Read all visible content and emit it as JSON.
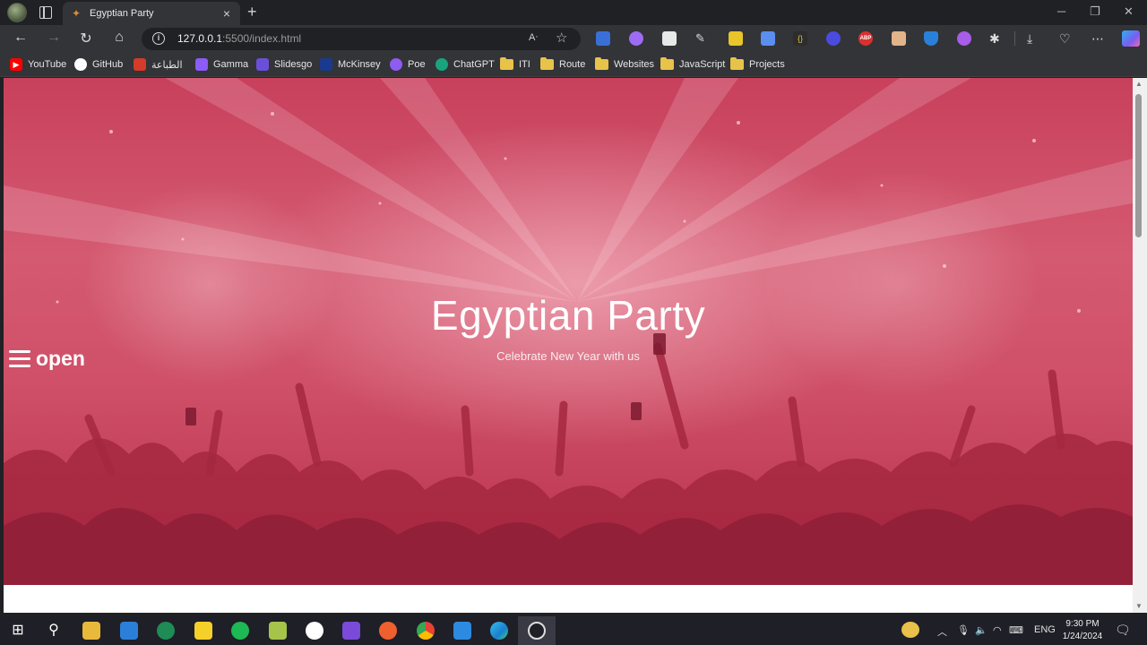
{
  "browser": {
    "tab_title": "Egyptian Party",
    "url_host": "127.0.0.1",
    "url_path": ":5500/index.html",
    "new_tab_symbol": "+",
    "close_tab_symbol": "×"
  },
  "bookmarks": [
    {
      "label": "YouTube",
      "icon": "youtube-icon",
      "color": "#ff0000"
    },
    {
      "label": "GitHub",
      "icon": "github-icon",
      "color": "#ffffff"
    },
    {
      "label": "الطباعة",
      "icon": "printing-icon",
      "color": "#d43b2a"
    },
    {
      "label": "Gamma",
      "icon": "gamma-icon",
      "color": "#8b5cf6"
    },
    {
      "label": "Slidesgo",
      "icon": "slidesgo-icon",
      "color": "#6b4fd8"
    },
    {
      "label": "McKinsey",
      "icon": "mckinsey-icon",
      "color": "#1a3a8f"
    },
    {
      "label": "Poe",
      "icon": "poe-icon",
      "color": "#8e5cf0"
    },
    {
      "label": "ChatGPT",
      "icon": "chatgpt-icon",
      "color": "#19a37f"
    },
    {
      "label": "ITI",
      "icon": "folder-icon"
    },
    {
      "label": "Route",
      "icon": "folder-icon"
    },
    {
      "label": "Websites",
      "icon": "folder-icon"
    },
    {
      "label": "JavaScript",
      "icon": "folder-icon"
    },
    {
      "label": "Projects",
      "icon": "folder-icon"
    }
  ],
  "page": {
    "title": "Egyptian Party",
    "subtitle": "Celebrate New Year with us",
    "menu_label": "open",
    "hero_color": "#c8405c"
  },
  "taskbar": {
    "time": "9:30 PM",
    "date": "1/24/2024",
    "language": "ENG"
  }
}
